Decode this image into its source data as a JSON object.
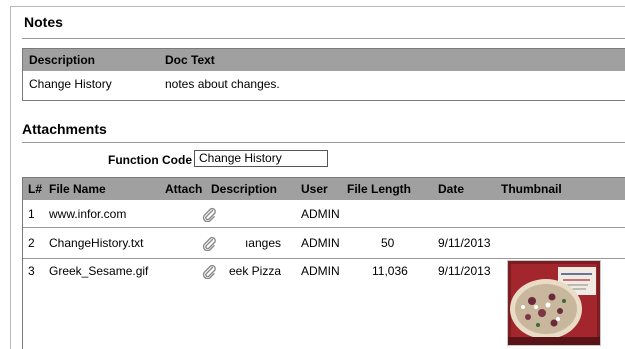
{
  "notes": {
    "title": "Notes",
    "columns": {
      "description": "Description",
      "doc_text": "Doc Text"
    },
    "rows": [
      {
        "description": "Change History",
        "doc_text": "notes about changes."
      }
    ]
  },
  "attachments": {
    "title": "Attachments",
    "function_code_label": "Function Code",
    "function_code_value": "Change History",
    "columns": {
      "line": "L#",
      "file_name": "File Name",
      "attach": "Attach",
      "description": "Description",
      "user": "User",
      "file_length": "File Length",
      "date": "Date",
      "thumbnail": "Thumbnail"
    },
    "rows": [
      {
        "line": "1",
        "file_name": "www.infor.com",
        "description": "",
        "user": "ADMIN",
        "file_length": "",
        "date": ""
      },
      {
        "line": "2",
        "file_name": "ChangeHistory.txt",
        "description": "ıanges",
        "user": "ADMIN",
        "file_length": "50",
        "date": "9/11/2013"
      },
      {
        "line": "3",
        "file_name": "Greek_Sesame.gif",
        "description": "eek Pizza",
        "user": "ADMIN",
        "file_length": "11,036",
        "date": "9/11/2013"
      }
    ],
    "icon": "paperclip-icon",
    "thumbnail_image": "pizza-box-thumbnail"
  },
  "colors": {
    "header_bg": "#a0a0a0",
    "rule": "#9a9a9a",
    "border": "#7a7a7a"
  }
}
